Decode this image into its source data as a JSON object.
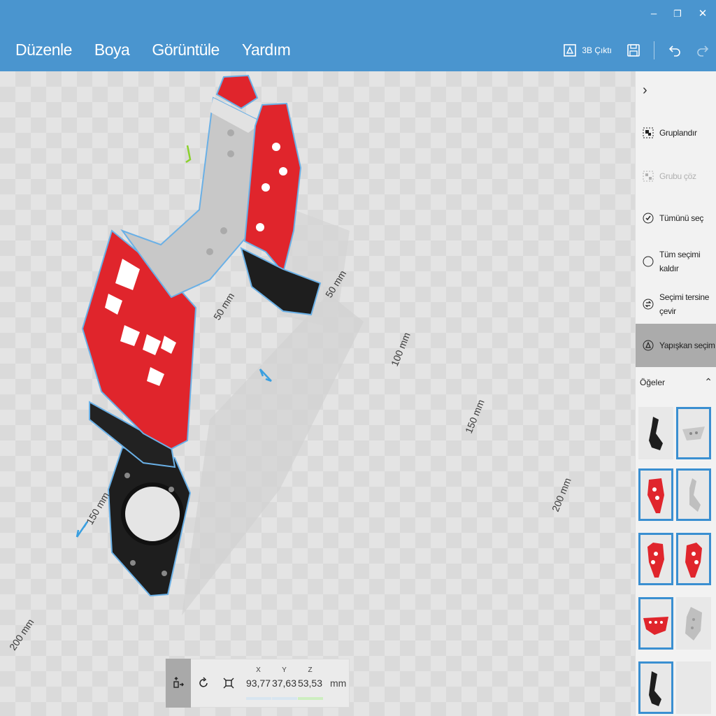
{
  "window": {
    "minimize": "–",
    "restore": "❐",
    "close": "✕"
  },
  "menu": [
    "Düzenle",
    "Boya",
    "Görüntüle",
    "Yardım"
  ],
  "toolbar": {
    "print_label": "3B Çıktı",
    "icons": [
      "print-3d-icon",
      "save-icon",
      "undo-icon",
      "redo-icon"
    ]
  },
  "viewport": {
    "dimension_labels": [
      "50 mm",
      "50 mm",
      "100 mm",
      "150 mm",
      "200 mm",
      "150 mm",
      "200 mm"
    ]
  },
  "transform": {
    "x_label": "X",
    "x_value": "93,77",
    "y_label": "Y",
    "y_value": "37,63",
    "z_label": "Z",
    "z_value": "53,53",
    "unit": "mm"
  },
  "panel": {
    "expand": "›",
    "commands": [
      {
        "label": "Gruplandır",
        "icon": "group-icon"
      },
      {
        "label": "Grubu çöz",
        "icon": "ungroup-icon"
      },
      {
        "label": "Tümünü seç",
        "icon": "select-all-icon"
      },
      {
        "label": "Tüm seçimi kaldır",
        "icon": "deselect-all-icon"
      },
      {
        "label": "Seçimi tersine çevir",
        "icon": "invert-selection-icon"
      },
      {
        "label": "Yapışkan seçim",
        "icon": "sticky-selection-icon"
      }
    ],
    "items_title": "Öğeler",
    "items_caret": "⌃"
  },
  "colors": {
    "accent": "#4a95cf",
    "selection_border": "#3a8fd1",
    "part_red": "#e0252c",
    "part_grey": "#c9c9c9",
    "part_black": "#1e1e1e"
  }
}
